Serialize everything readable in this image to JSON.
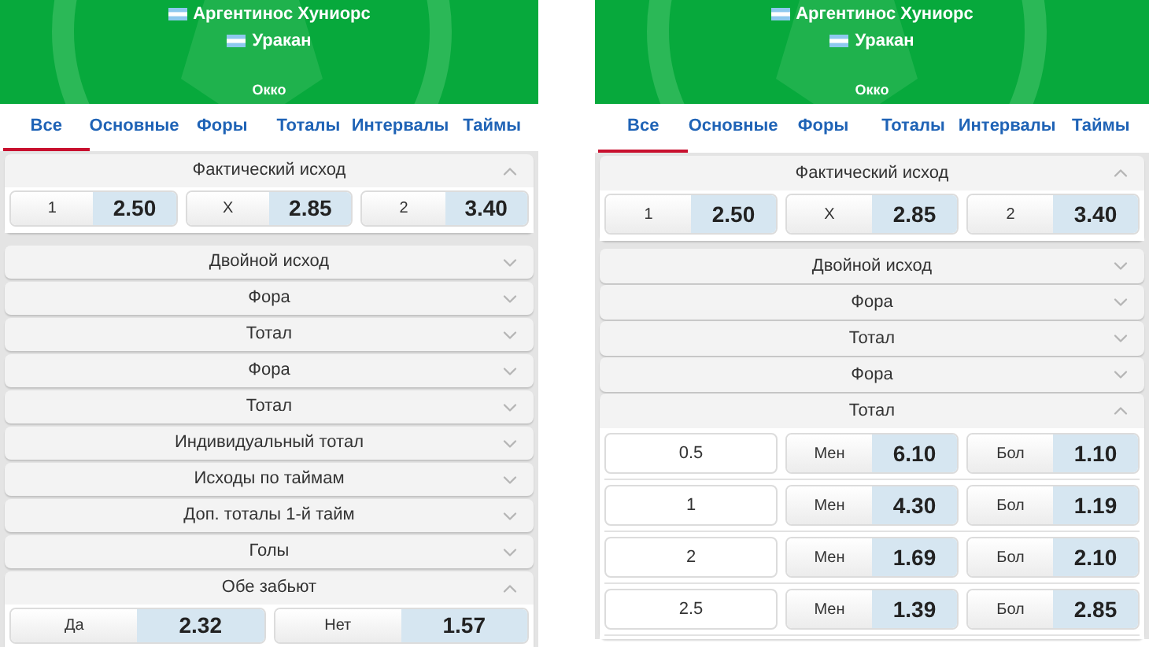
{
  "screens": [
    {
      "header": {
        "team_1": "Аргентинос Хуниорс",
        "team_2": "Уракан",
        "channel": "Окко"
      },
      "tabs": [
        {
          "label": "Все",
          "selected": true
        },
        {
          "label": "Основные",
          "selected": false
        },
        {
          "label": "Форы",
          "selected": false
        },
        {
          "label": "Тоталы",
          "selected": false
        },
        {
          "label": "Интервалы",
          "selected": false
        },
        {
          "label": "Таймы",
          "selected": false
        }
      ],
      "markets": [
        {
          "title": "Фактический исход",
          "expanded": true,
          "rows": [
            [
              {
                "kind": "odds",
                "label": "1",
                "value": "2.50"
              },
              {
                "kind": "odds",
                "label": "X",
                "value": "2.85"
              },
              {
                "kind": "odds",
                "label": "2",
                "value": "3.40"
              }
            ]
          ]
        },
        {
          "title": "Двойной исход",
          "expanded": false
        },
        {
          "title": "Фора",
          "expanded": false
        },
        {
          "title": "Тотал",
          "expanded": false
        },
        {
          "title": "Фора",
          "expanded": false
        },
        {
          "title": "Тотал",
          "expanded": false
        },
        {
          "title": "Индивидуальный тотал",
          "expanded": false
        },
        {
          "title": "Исходы по таймам",
          "expanded": false
        },
        {
          "title": "Доп. тоталы 1-й тайм",
          "expanded": false
        },
        {
          "title": "Голы",
          "expanded": false
        },
        {
          "title": "Обе забьют",
          "expanded": true,
          "rows": [
            [
              {
                "kind": "odds",
                "label": "Да",
                "value": "2.32"
              },
              {
                "kind": "odds",
                "label": "Нет",
                "value": "1.57"
              }
            ]
          ]
        }
      ]
    },
    {
      "header": {
        "team_1": "Аргентинос Хуниорс",
        "team_2": "Уракан",
        "channel": "Окко"
      },
      "tabs": [
        {
          "label": "Все",
          "selected": true
        },
        {
          "label": "Основные",
          "selected": false
        },
        {
          "label": "Форы",
          "selected": false
        },
        {
          "label": "Тоталы",
          "selected": false
        },
        {
          "label": "Интервалы",
          "selected": false
        },
        {
          "label": "Таймы",
          "selected": false
        }
      ],
      "markets": [
        {
          "title": "Фактический исход",
          "expanded": true,
          "rows": [
            [
              {
                "kind": "odds",
                "label": "1",
                "value": "2.50"
              },
              {
                "kind": "odds",
                "label": "X",
                "value": "2.85"
              },
              {
                "kind": "odds",
                "label": "2",
                "value": "3.40"
              }
            ]
          ]
        },
        {
          "title": "Двойной исход",
          "expanded": false
        },
        {
          "title": "Фора",
          "expanded": false
        },
        {
          "title": "Тотал",
          "expanded": false
        },
        {
          "title": "Фора",
          "expanded": false
        },
        {
          "title": "Тотал",
          "expanded": true,
          "rows": [
            [
              {
                "kind": "line",
                "label": "0.5"
              },
              {
                "kind": "odds",
                "label": "Мен",
                "value": "6.10"
              },
              {
                "kind": "odds",
                "label": "Бол",
                "value": "1.10"
              }
            ],
            [
              {
                "kind": "line",
                "label": "1"
              },
              {
                "kind": "odds",
                "label": "Мен",
                "value": "4.30"
              },
              {
                "kind": "odds",
                "label": "Бол",
                "value": "1.19"
              }
            ],
            [
              {
                "kind": "line",
                "label": "2"
              },
              {
                "kind": "odds",
                "label": "Мен",
                "value": "1.69"
              },
              {
                "kind": "odds",
                "label": "Бол",
                "value": "2.10"
              }
            ],
            [
              {
                "kind": "line",
                "label": "2.5"
              },
              {
                "kind": "odds",
                "label": "Мен",
                "value": "1.39"
              },
              {
                "kind": "odds",
                "label": "Бол",
                "value": "2.85"
              }
            ]
          ]
        }
      ]
    }
  ]
}
